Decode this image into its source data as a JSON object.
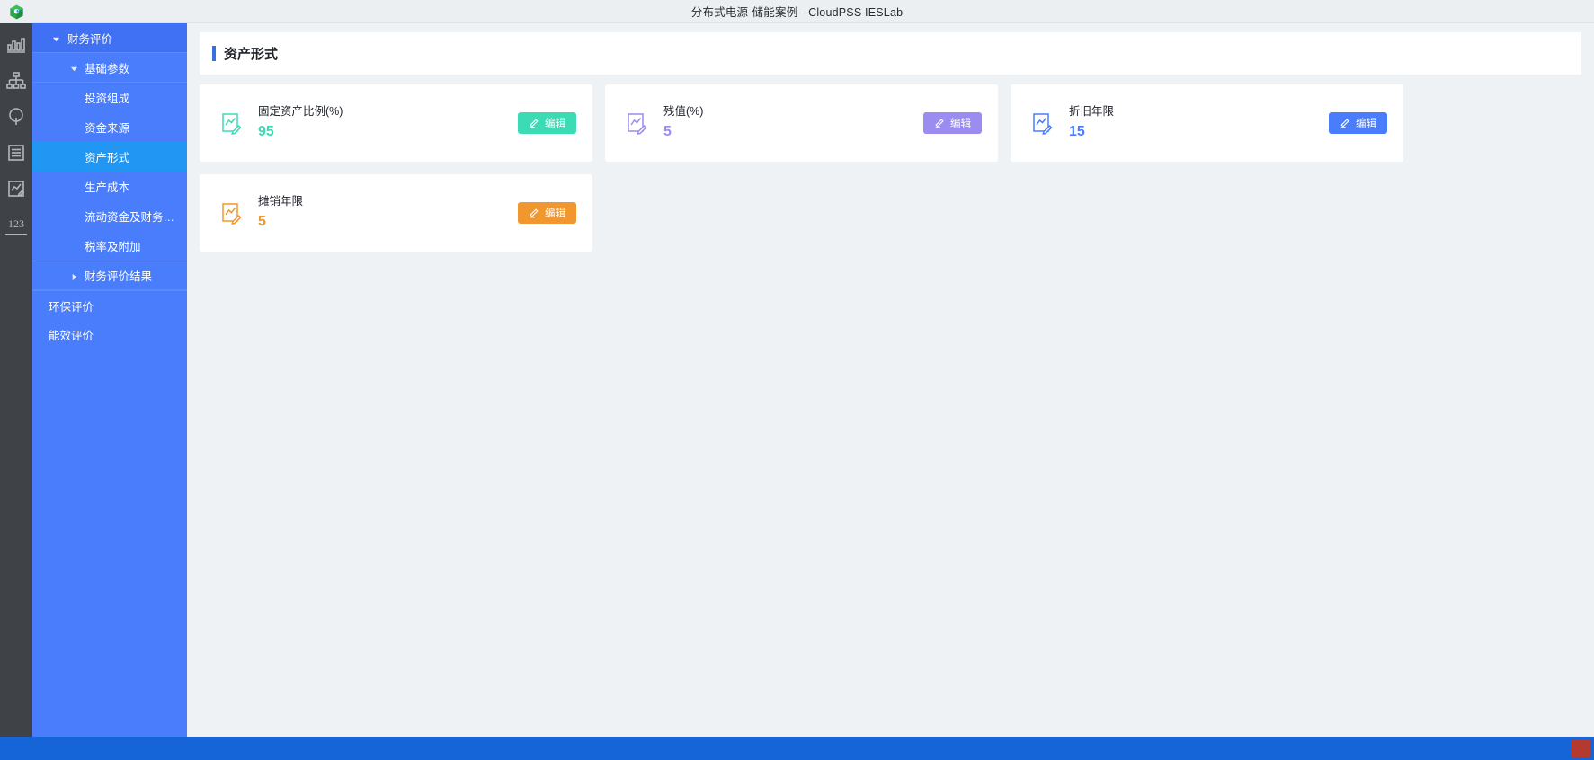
{
  "window": {
    "title": "分布式电源-储能案例 - CloudPSS IESLab",
    "app_icon": "cloudpss-logo-icon"
  },
  "rail": {
    "items": [
      {
        "name": "bar-chart-icon",
        "label": ""
      },
      {
        "name": "topology-icon",
        "label": ""
      },
      {
        "name": "lightbulb-icon",
        "label": ""
      },
      {
        "name": "list-icon",
        "label": ""
      },
      {
        "name": "edit-chart-icon",
        "label": ""
      },
      {
        "name": "number-icon",
        "label": "123"
      }
    ]
  },
  "sidebar": {
    "items": [
      {
        "label": "财务评价",
        "level": 0,
        "caret": "down",
        "active": false
      },
      {
        "label": "基础参数",
        "level": 1,
        "caret": "down",
        "active": false
      },
      {
        "label": "投资组成",
        "level": 2,
        "caret": "none",
        "active": false
      },
      {
        "label": "资金来源",
        "level": 2,
        "caret": "none",
        "active": false
      },
      {
        "label": "资产形式",
        "level": 2,
        "caret": "none",
        "active": true
      },
      {
        "label": "生产成本",
        "level": 2,
        "caret": "none",
        "active": false
      },
      {
        "label": "流动资金及财务…",
        "level": 2,
        "caret": "none",
        "active": false
      },
      {
        "label": "税率及附加",
        "level": 2,
        "caret": "none",
        "active": false
      },
      {
        "label": "财务评价结果",
        "level": 1,
        "caret": "right",
        "active": false
      },
      {
        "label": "环保评价",
        "level": "plain",
        "caret": "none",
        "active": false
      },
      {
        "label": "能效评价",
        "level": "plain",
        "caret": "none",
        "active": false
      }
    ]
  },
  "page": {
    "title": "资产形式",
    "accent_bar_color": "#3a6fe0"
  },
  "cards": [
    {
      "label": "固定资产比例(%)",
      "value": "95",
      "color": "#3ddbb5",
      "button_label": "编辑",
      "icon": "edit-chart-icon"
    },
    {
      "label": "残值(%)",
      "value": "5",
      "color": "#9b8cf0",
      "button_label": "编辑",
      "icon": "edit-chart-icon"
    },
    {
      "label": "折旧年限",
      "value": "15",
      "color": "#4a7dfc",
      "button_label": "编辑",
      "icon": "edit-chart-icon"
    },
    {
      "label": "摊销年限",
      "value": "5",
      "color": "#f0972f",
      "button_label": "编辑",
      "icon": "edit-chart-icon"
    }
  ],
  "taskbar": {
    "tray_icon": "tray-app-icon"
  }
}
